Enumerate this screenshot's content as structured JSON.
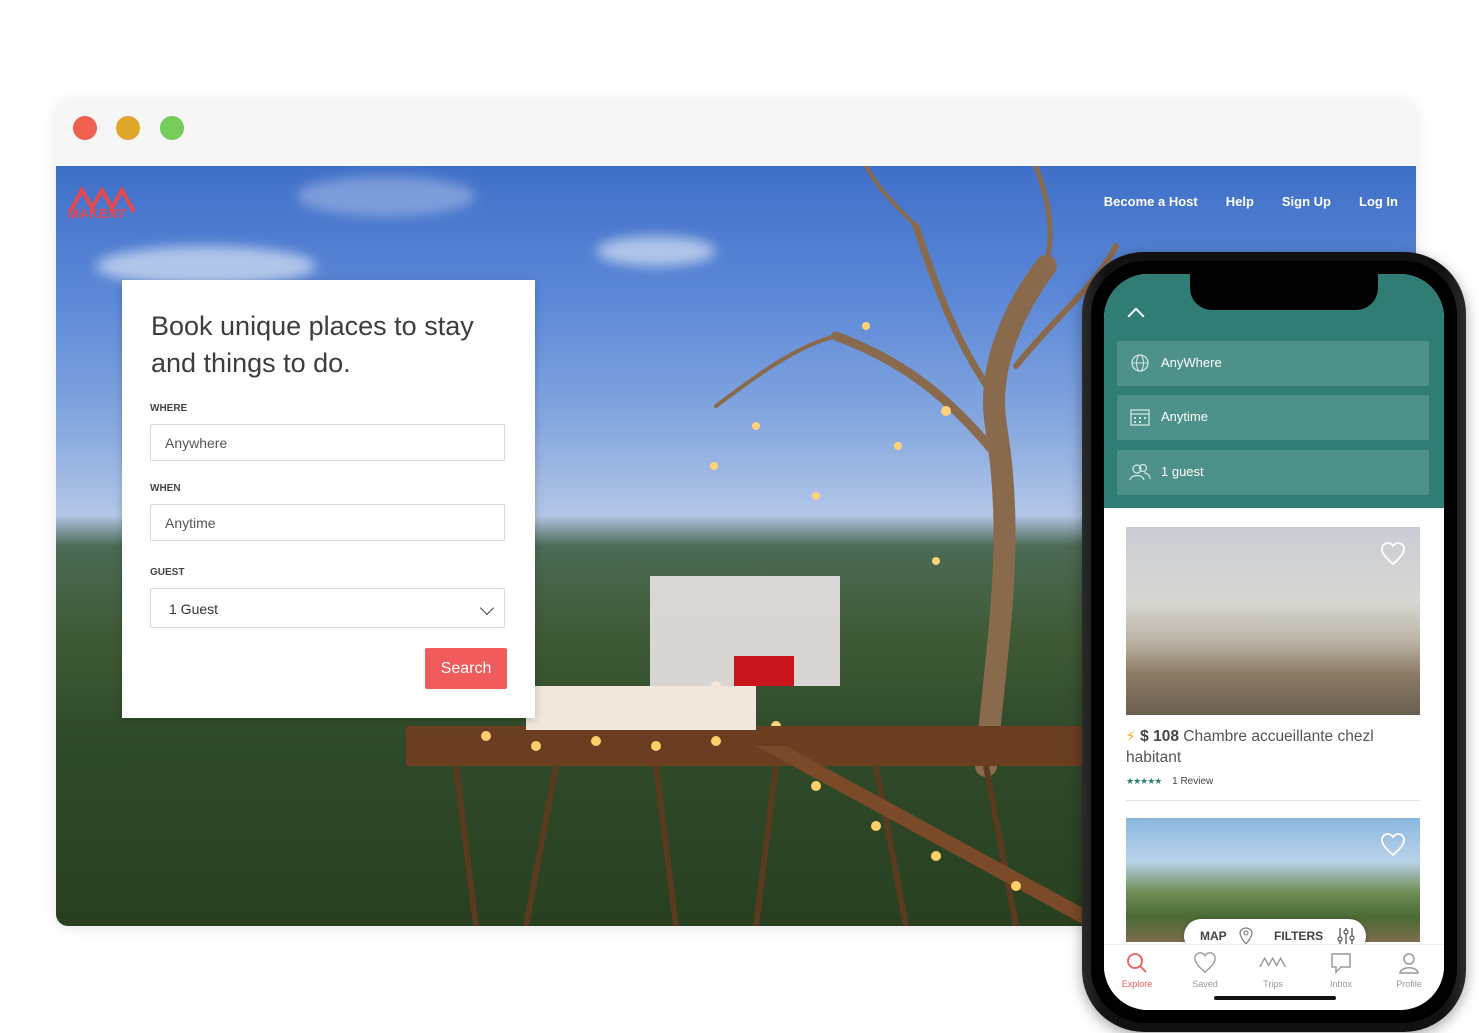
{
  "browser": {
    "logo_text": "MAKENT",
    "nav": [
      "Become a Host",
      "Help",
      "Sign Up",
      "Log In"
    ]
  },
  "search_card": {
    "heading": "Book unique places to stay and things to do.",
    "where_label": "WHERE",
    "where_placeholder": "Anywhere",
    "when_label": "WHEN",
    "when_placeholder": "Anytime",
    "guest_label": "GUEST",
    "guest_value": "1 Guest",
    "search_button": "Search"
  },
  "phone": {
    "filters": [
      "AnyWhere",
      "Anytime",
      "1 guest"
    ],
    "listing": {
      "price": "$ 108",
      "title": "Chambre accueillante chezl habitant",
      "reviews": "1 Review",
      "stars": 5
    },
    "map_label": "MAP",
    "filters_label": "FILTERS",
    "tabs": [
      "Explore",
      "Saved",
      "Trips",
      "Inbox",
      "Profile"
    ]
  },
  "colors": {
    "accent": "#f15b5b",
    "teal": "#2f7d75"
  }
}
